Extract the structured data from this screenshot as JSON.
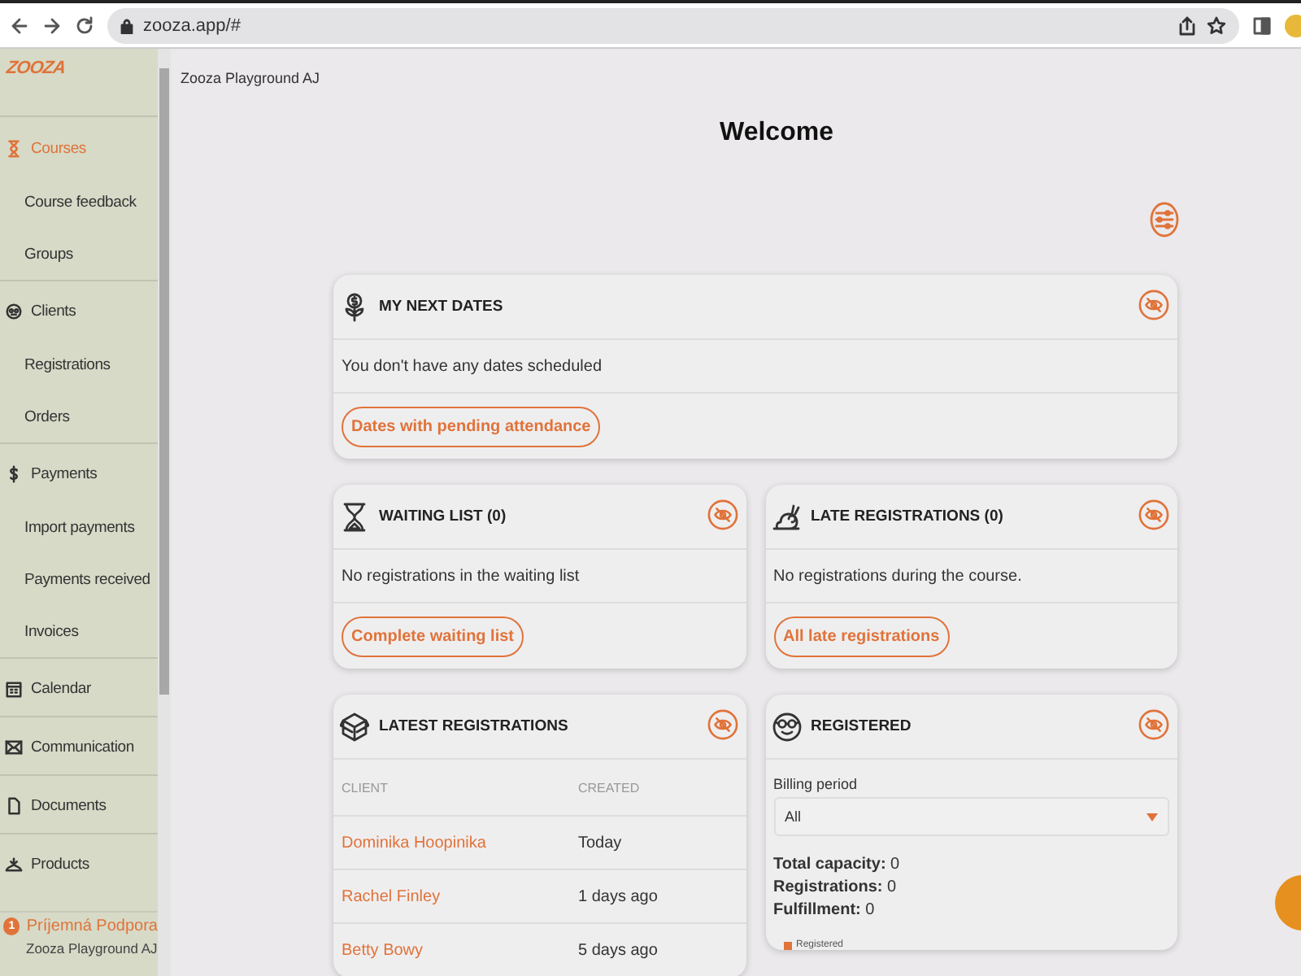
{
  "browser": {
    "url": "zooza.app/#"
  },
  "sidebar": {
    "logo": "ZOOZA",
    "items": [
      {
        "label": "Courses",
        "kind": "section",
        "selected": true
      },
      {
        "label": "Course feedback",
        "kind": "sub",
        "selected": false
      },
      {
        "label": "Groups",
        "kind": "sub",
        "selected": false
      },
      {
        "label": "Clients",
        "kind": "section",
        "selected": false
      },
      {
        "label": "Registrations",
        "kind": "sub",
        "selected": false
      },
      {
        "label": "Orders",
        "kind": "sub",
        "selected": false
      },
      {
        "label": "Payments",
        "kind": "section",
        "selected": false
      },
      {
        "label": "Import payments",
        "kind": "sub",
        "selected": false
      },
      {
        "label": "Payments received",
        "kind": "sub",
        "selected": false
      },
      {
        "label": "Invoices",
        "kind": "sub",
        "selected": false
      },
      {
        "label": "Calendar",
        "kind": "section",
        "selected": false
      },
      {
        "label": "Communication",
        "kind": "section",
        "selected": false
      },
      {
        "label": "Documents",
        "kind": "section",
        "selected": false
      },
      {
        "label": "Products",
        "kind": "section",
        "selected": false
      }
    ],
    "footer": {
      "badge": "1",
      "name": "Príjemná Podpora",
      "org": "Zooza Playground AJ"
    }
  },
  "main": {
    "breadcrumb": "Zooza Playground AJ",
    "title": "Welcome"
  },
  "card_rows": [
    [
      {
        "kind": "message",
        "title": "MY NEXT DATES",
        "message": "You don't have any dates scheduled",
        "button": "Dates with pending attendance"
      }
    ],
    [
      {
        "kind": "message",
        "title": "WAITING LIST (0)",
        "message": "No registrations in the waiting list",
        "button": "Complete waiting list"
      },
      {
        "kind": "message",
        "title": "LATE REGISTRATIONS (0)",
        "message": "No registrations during the course.",
        "button": "All late registrations"
      }
    ],
    [
      {
        "kind": "table",
        "title": "LATEST REGISTRATIONS",
        "columns": [
          "CLIENT",
          "CREATED"
        ],
        "rows": [
          {
            "client": "Dominika Hoopinika",
            "created": "Today"
          },
          {
            "client": "Rachel Finley",
            "created": "1 days ago"
          },
          {
            "client": "Betty Bowy",
            "created": "5 days ago"
          }
        ]
      },
      {
        "kind": "stats",
        "title": "REGISTERED",
        "field_label": "Billing period",
        "field_value": "All",
        "stats": [
          "**Total capacity:** 0",
          "**Registrations:** 0",
          "**Fulfillment:** 0"
        ],
        "legend": [
          {
            "label": "Registered",
            "color": "#e0733a"
          }
        ]
      }
    ]
  ]
}
